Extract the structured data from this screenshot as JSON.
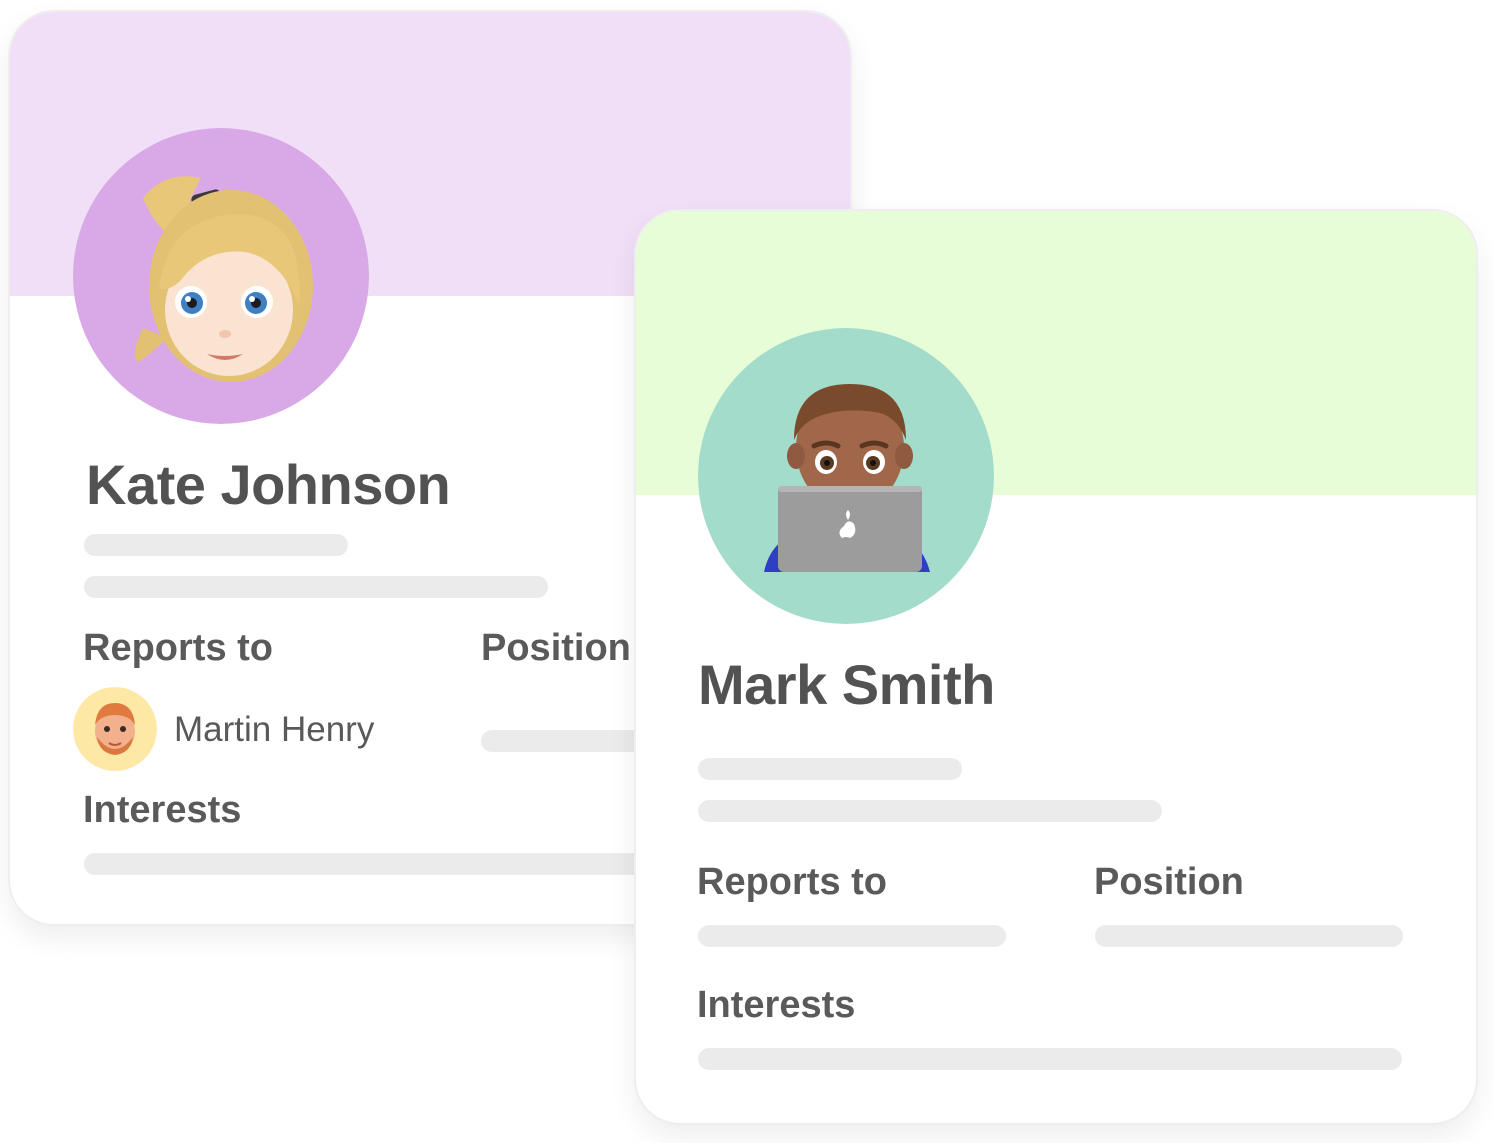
{
  "cards": [
    {
      "name": "Kate Johnson",
      "banner_color": "#f0dff6",
      "avatar_bg": "#d9a9e7",
      "avatar_icon": "blonde-woman-emoji-icon",
      "reports_to_label": "Reports to",
      "position_label": "Position",
      "interests_label": "Interests",
      "reports_to_person": {
        "name": "Martin Henry",
        "avatar_bg": "#fde8a6",
        "avatar_icon": "red-haired-man-emoji-icon"
      }
    },
    {
      "name": "Mark Smith",
      "banner_color": "#e6fdd8",
      "avatar_bg": "#a3dccb",
      "avatar_icon": "man-technologist-emoji-icon",
      "reports_to_label": "Reports to",
      "position_label": "Position",
      "interests_label": "Interests"
    }
  ],
  "placeholder_color": "#ebebeb"
}
